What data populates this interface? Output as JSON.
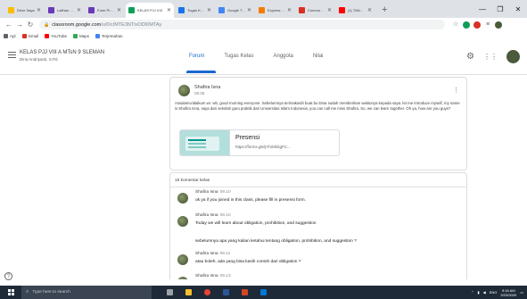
{
  "browser": {
    "tabs": [
      {
        "label": "Drive Saya",
        "color": "#fbbc04",
        "active": false
      },
      {
        "label": "Latihan soal",
        "color": "#673ab7",
        "active": false
      },
      {
        "label": "Form Presensi",
        "color": "#673ab7",
        "active": false
      },
      {
        "label": "KELAS PJJ VIII",
        "color": "#0f9d58",
        "active": true
      },
      {
        "label": "Tugas Kelas",
        "color": "#1a73e8",
        "active": false
      },
      {
        "label": "Google Terjemahan",
        "color": "#4285f4",
        "active": false
      },
      {
        "label": "Express sentence",
        "color": "#f57c00",
        "active": false
      },
      {
        "label": "Common Expressions",
        "color": "#d93025",
        "active": false
      },
      {
        "label": "(1) TANGGAPAN",
        "color": "#ff0000",
        "active": false
      }
    ],
    "new_tab": "+",
    "window_controls": [
      "—",
      "❐",
      "✕"
    ],
    "url_host": "classroom.google.com",
    "url_path": "/u/0/c/MTE3NTIxODI0MTAy",
    "bookmarks": [
      {
        "label": "Apl",
        "color": "#5f6368"
      },
      {
        "label": "Gmail",
        "color": "#d93025"
      },
      {
        "label": "YouTube",
        "color": "#ff0000"
      },
      {
        "label": "Maps",
        "color": "#34a853"
      },
      {
        "label": "Terjemahan",
        "color": "#4285f4"
      }
    ]
  },
  "classroom": {
    "class_title": "KELAS PJJ VIII A MTsN 9 SLEMAN",
    "teacher": "Dina Andriyanti, S.Pd",
    "nav_tabs": [
      "Forum",
      "Tugas Kelas",
      "Anggota",
      "Nilai"
    ],
    "active_tab": "Forum"
  },
  "post": {
    "author": "Shafira Isna",
    "time": "09.08",
    "text": "Assalamu'alaikum wr. wb, good morning everyone. Sebelumnya terimakasih buat bu Dina sudah memberikan waktunya kepada saya. let me introduce myself, my name is Shafira Isna, saya dari sekolah guru praktik dari Universitas Islam Indonesia, you can call me miss Shafira. So, we can learn together. Oh ya, how are you guys?",
    "attachment": {
      "title": "Presensi",
      "url": "https://forms.gle/jYhiShiitgFC..."
    }
  },
  "comments": {
    "count_label": "15 komentar kelas",
    "items": [
      {
        "author": "Shafira Isna",
        "time": "09.10",
        "text": "ok ya if you joined in this class, please fill in presensi form.",
        "extra": ""
      },
      {
        "author": "Shafira Isna",
        "time": "09.10",
        "text": "Today we will learn about obligation, prohibition, and suggestion",
        "extra": "sebelumnya apa yang kalian ketahui tentang obligation, prohibition, and suggestion ?"
      },
      {
        "author": "Shafira Isna",
        "time": "09.11",
        "text": "atau boleh, ada yang bisa kasih contoh dari obligation ?",
        "extra": ""
      },
      {
        "author": "Shafira Isna",
        "time": "09.13",
        "text": "",
        "extra": ""
      }
    ]
  },
  "help_label": "?",
  "taskbar": {
    "search_placeholder": "Type here to search",
    "lang": "ENG",
    "time": "9:16 AM",
    "date": "3/23/2020",
    "apps": [
      {
        "name": "task-view",
        "color": "#9aa0a6"
      },
      {
        "name": "file-explorer",
        "color": "#fbc02d"
      },
      {
        "name": "chrome",
        "color": "#ea4335"
      },
      {
        "name": "word",
        "color": "#2b579a"
      },
      {
        "name": "powerpoint",
        "color": "#d24726"
      },
      {
        "name": "store",
        "color": "#0078d7"
      }
    ]
  }
}
